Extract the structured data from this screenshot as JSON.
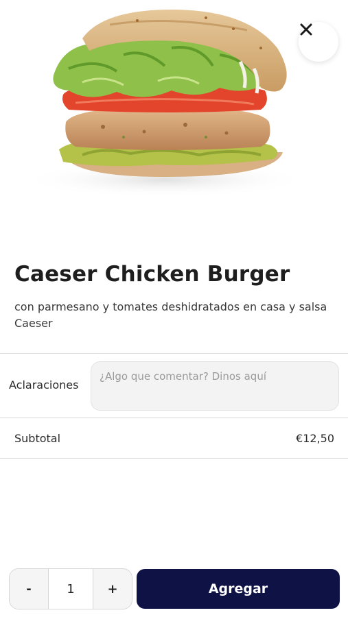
{
  "product": {
    "title": "Caeser Chicken Burger",
    "description": "con parmesano y tomates deshidratados en casa y salsa Caeser"
  },
  "notes": {
    "label": "Aclaraciones",
    "placeholder": "¿Algo que comentar? Dinos aquí",
    "value": ""
  },
  "subtotal": {
    "label": "Subtotal",
    "value": "€12,50"
  },
  "quantity": {
    "decrement_label": "-",
    "value": "1",
    "increment_label": "+"
  },
  "actions": {
    "add_label": "Agregar",
    "close_icon": "close-icon"
  },
  "colors": {
    "primary": "#0e1245",
    "divider": "#d9d9d9",
    "input_bg": "#f3f3f3"
  }
}
